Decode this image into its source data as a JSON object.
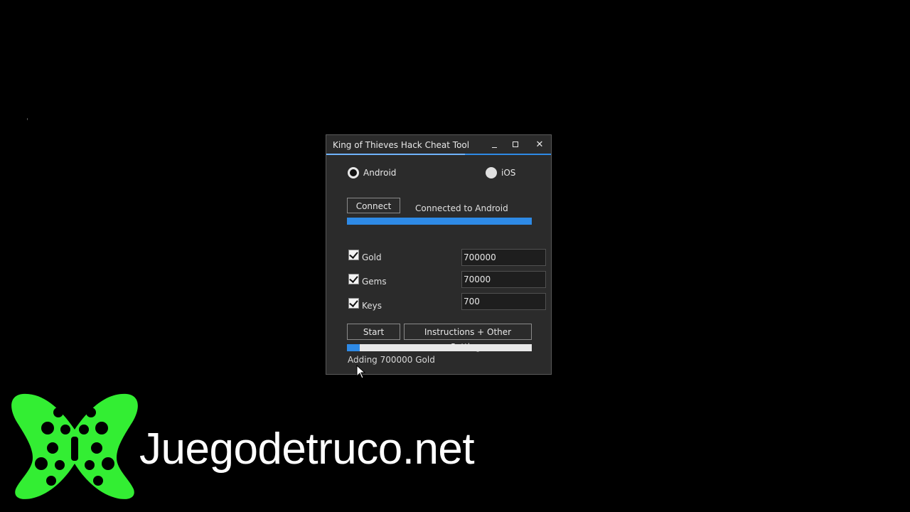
{
  "window": {
    "title": "King of Thieves Hack Cheat Tool",
    "minimize_glyph": "_",
    "maximize_glyph": "□",
    "close_glyph": "✕"
  },
  "platform": {
    "options": [
      {
        "label": "Android",
        "selected": true
      },
      {
        "label": "iOS",
        "selected": false
      }
    ]
  },
  "connect": {
    "button_label": "Connect",
    "status": "Connected to Android",
    "progress": 1.0
  },
  "resources": [
    {
      "label": "Gold",
      "checked": true,
      "value": "700000"
    },
    {
      "label": "Gems",
      "checked": true,
      "value": "70000"
    },
    {
      "label": "Keys",
      "checked": true,
      "value": "700"
    }
  ],
  "actions": {
    "start_label": "Start",
    "instructions_label": "Instructions + Other Settings",
    "progress": 0.07,
    "status": "Adding 700000 Gold"
  },
  "watermark": {
    "text": "Juegodetruco.net",
    "logo_icon": "gamepad-butterfly-icon",
    "logo_color": "#33ee33"
  },
  "colors": {
    "accent": "#2e8ae6",
    "window_bg": "#2b2b2b",
    "page_bg": "#000000"
  }
}
